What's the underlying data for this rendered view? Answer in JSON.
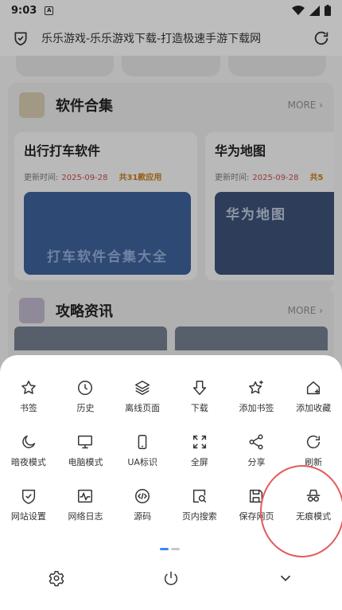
{
  "status": {
    "time": "9:03",
    "app_badge": "A"
  },
  "urlbar": {
    "title": "乐乐游戏-乐乐游戏下载-打造极速手游下载网"
  },
  "page": {
    "section1": {
      "title": "软件合集",
      "more": "MORE",
      "cards": [
        {
          "title": "出行打车软件",
          "updated_label": "更新时间:",
          "date": "2025-09-28",
          "count": "共31款应用",
          "banner_text": "打车软件合集大全"
        },
        {
          "title": "华为地图",
          "updated_label": "更新时间:",
          "date": "2025-09-28",
          "count": "共5",
          "banner_text": "华为地图"
        }
      ]
    },
    "section2": {
      "title": "攻略资讯",
      "more": "MORE"
    }
  },
  "menu": {
    "items": [
      {
        "label": "书签",
        "icon": "star-icon"
      },
      {
        "label": "历史",
        "icon": "clock-icon"
      },
      {
        "label": "离线页面",
        "icon": "layers-icon"
      },
      {
        "label": "下载",
        "icon": "download-icon"
      },
      {
        "label": "添加书签",
        "icon": "star-plus-icon"
      },
      {
        "label": "添加收藏",
        "icon": "home-plus-icon"
      },
      {
        "label": "暗夜模式",
        "icon": "moon-icon"
      },
      {
        "label": "电脑模式",
        "icon": "monitor-icon"
      },
      {
        "label": "UA标识",
        "icon": "phone-icon"
      },
      {
        "label": "全屏",
        "icon": "fullscreen-icon"
      },
      {
        "label": "分享",
        "icon": "share-icon"
      },
      {
        "label": "刷新",
        "icon": "refresh-icon"
      },
      {
        "label": "网站设置",
        "icon": "shield-check-icon"
      },
      {
        "label": "网络日志",
        "icon": "pulse-icon"
      },
      {
        "label": "源码",
        "icon": "code-icon"
      },
      {
        "label": "页内搜索",
        "icon": "search-page-icon"
      },
      {
        "label": "保存网页",
        "icon": "save-icon"
      },
      {
        "label": "无痕模式",
        "icon": "incognito-icon"
      }
    ],
    "bottom": {
      "settings_icon": "gear-icon",
      "power_icon": "power-icon",
      "collapse_icon": "chevron-down-icon"
    }
  },
  "colors": {
    "accent": "#3a86ff",
    "highlight": "#e45b5b"
  }
}
